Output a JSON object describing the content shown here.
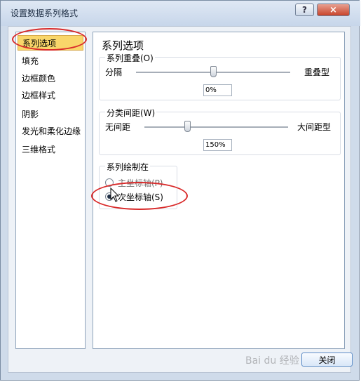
{
  "window": {
    "title": "设置数据系列格式",
    "help_label": "?",
    "close_label": "×"
  },
  "sidebar": {
    "items": [
      {
        "label": "系列选项",
        "selected": true
      },
      {
        "label": "填充"
      },
      {
        "label": "边框颜色"
      },
      {
        "label": "边框样式"
      },
      {
        "label": "阴影"
      },
      {
        "label": "发光和柔化边缘"
      },
      {
        "label": "三维格式"
      }
    ]
  },
  "main": {
    "title": "系列选项",
    "overlap": {
      "group_label": "系列重叠(O)",
      "left_label": "分隔",
      "right_label": "重叠型",
      "value": "0%",
      "slider_fraction": 0.5
    },
    "gap": {
      "group_label": "分类间距(W)",
      "left_label": "无间距",
      "right_label": "大间距型",
      "value": "150%",
      "slider_fraction": 0.3
    },
    "plot_on": {
      "group_label": "系列绘制在",
      "options": [
        {
          "label": "主坐标轴(P)",
          "selected": false
        },
        {
          "label": "次坐标轴(S)",
          "selected": true
        }
      ]
    }
  },
  "footer": {
    "close_label": "关闭"
  },
  "watermark": "Bai du 经验",
  "colors": {
    "selected_nav": "#f9d66a",
    "highlight_ellipse": "#d92a2a",
    "window_bg": "#cfdbea"
  }
}
